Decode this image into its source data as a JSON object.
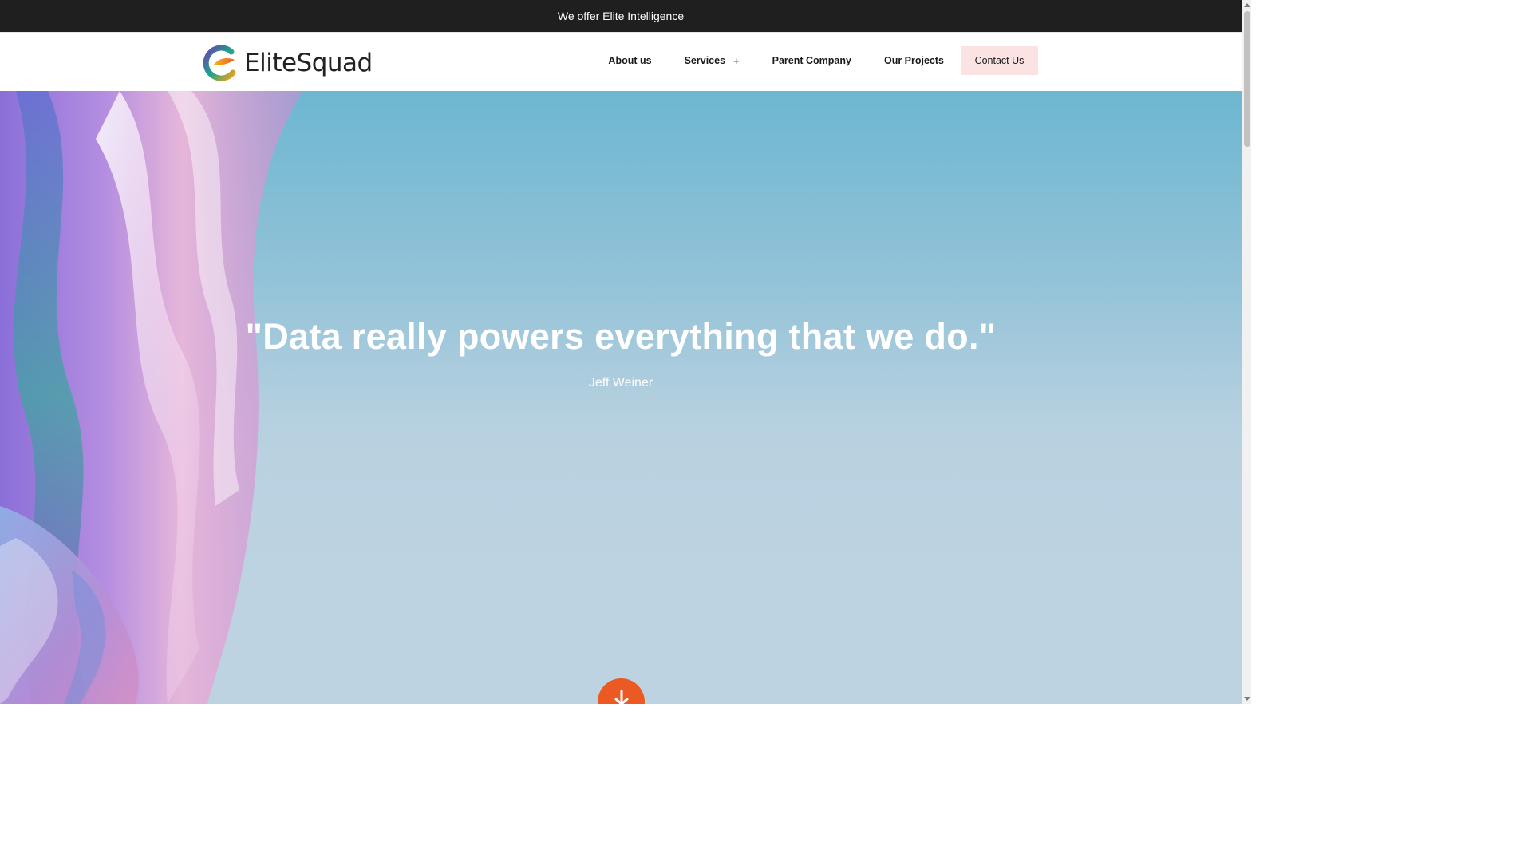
{
  "announcement": {
    "text": "We offer Elite Intelligence"
  },
  "header": {
    "logo_text": "EliteSquad",
    "nav": [
      {
        "label": "About us"
      },
      {
        "label": "Services",
        "expand_symbol": "+"
      },
      {
        "label": "Parent Company"
      },
      {
        "label": "Our Projects"
      }
    ],
    "contact_label": "Contact Us"
  },
  "hero": {
    "quote": "\"Data really powers everything that we do.\"",
    "author": "Jeff Weiner",
    "scroll_icon": "download-arrow-icon"
  },
  "colors": {
    "topbar_bg": "#1f1f1f",
    "contact_bg": "#fbe3e3",
    "scroll_button": "#ec5a24",
    "hero_sky_top": "#6db7d1",
    "hero_sky_bottom": "#bdd3e2"
  }
}
